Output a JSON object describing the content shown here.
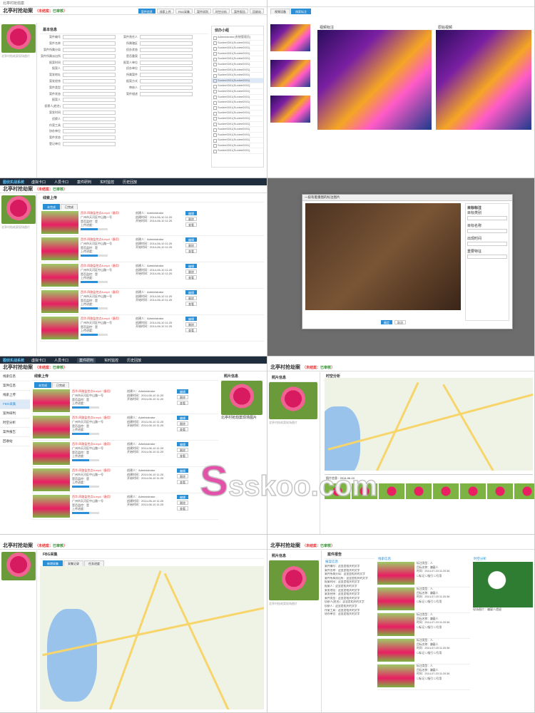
{
  "app": {
    "name": "图侦实战系统",
    "nav": [
      "虚拟卡口",
      "人员卡口",
      "案件研判",
      "实时监控",
      "历史回放"
    ]
  },
  "case": {
    "title": "北亭村抢劫案",
    "status_open": "未结案",
    "status_review": "已审核",
    "breadcrumb": "北亭村抢劫案"
  },
  "toolbar": [
    "案件信息",
    "线索上传",
    "FBG采集",
    "案件研判",
    "时空分析",
    "案件报告",
    "回收站"
  ],
  "panel1": {
    "side_caption": "北亭村抢劫案现场图片",
    "section_basic": "基本信息",
    "section_people": "侦办小组",
    "fields_left": [
      "案件编号",
      "案件名称",
      "案件所属分局",
      "案件所属派出所",
      "报案时间",
      "报案人",
      "案发地址",
      "案发经纬",
      "案件类型",
      "案件状态",
      "报案人",
      "侦察人(姓名)",
      "案发时间",
      "侦察人",
      "作案工具",
      "协办单位",
      "案件状态",
      "登记单位"
    ],
    "fields_right": [
      "案件责任人",
      "所属辖区",
      "侦办状态",
      "是否重案",
      "报案人单位",
      "侦办单位",
      "所属案件",
      "报案方式",
      "审核人",
      "案件描述"
    ],
    "people_header": "Administrator(系统管理员)",
    "people": [
      "Sunlee0001(Sunlee0001)",
      "Sunlee0001(Sunlee0001)",
      "Sunlee0001(Sunlee0001)",
      "Sunlee0001(Sunlee0001)",
      "Sunlee0001(Sunlee0001)",
      "Sunlee0001(Sunlee0001)",
      "Sunlee0001(Sunlee0001)",
      "Sunlee0001(Sunlee0001)",
      "Sunlee0001(Sunlee0001)",
      "Sunlee0001(Sunlee0001)",
      "Sunlee0001(Sunlee0001)",
      "Sunlee0001(Sunlee0001)",
      "Sunlee0001(Sunlee0001)",
      "Sunlee0001(Sunlee0001)",
      "Sunlee0001(Sunlee0001)",
      "Sunlee0001(Sunlee0001)",
      "Sunlee0001(Sunlee0001)",
      "Sunlee0001(Sunlee0001)",
      "Sunlee0001(Sunlee0001)",
      "Sunlee0001(Sunlee0001)",
      "Sunlee0001(Sunlee0001)"
    ]
  },
  "panel2": {
    "tabs": [
      "视频设备",
      "线索标注"
    ],
    "left_video": "视频标注",
    "right_video": "原始视频",
    "btn_label": "标注",
    "btn_delete": "删除"
  },
  "panel3": {
    "section": "线索上传",
    "tabs": [
      "未完成",
      "已完成"
    ],
    "upload_opts": [
      "翻拍",
      "上传视频",
      "上传图片",
      "上传文件"
    ],
    "title": "西华-四路监控点A.mp4（备用）",
    "addr": "广州市天河区中山路一号",
    "cam": "是否监控：是",
    "uploader": "创建人：Administrator",
    "time1": "创建时间：2014-06-10 11:20",
    "time2": "开始时间：2014-06-10 11:20",
    "pct_label": "上传进度：",
    "pct": 0.62,
    "actions": [
      "编辑",
      "删除",
      "查看"
    ]
  },
  "panel4": {
    "title": "一段有着重图的标注图片",
    "annot_title": "目标标注",
    "annot_fields": [
      "目标类别",
      "目标名称",
      "出现时间",
      "重要特征"
    ],
    "ok": "确定",
    "cancel": "取消",
    "color_label": "颜色选择"
  },
  "panel5": {
    "menu": [
      "线索信息",
      "案件信息",
      "线索上传",
      "FBG采集",
      "案件研判",
      "时空分析",
      "案件报告",
      "回收站"
    ],
    "side_title": "照片信息",
    "side_caption": "北亭村抢劫案现场图片"
  },
  "panel6": {
    "side_title": "照片信息",
    "section": "时空分析",
    "side_caption": "北亭村抢劫案现场图片",
    "timeline": "2014-06-10",
    "film_label": "照片信息",
    "play_label": "播放"
  },
  "panel7": {
    "section": "FBG采集",
    "tabs": [
      "新增采集",
      "采集记录",
      "任务进度"
    ],
    "right_link": "查看采集"
  },
  "panel8": {
    "side_title": "照片信息",
    "section": "案件报告",
    "sub1": "报案信息",
    "sub2": "线索信息",
    "sub3": "时空分析",
    "report_lines": [
      "案件编号：这里是相关的文字",
      "案件名称：这里是相关的文字",
      "案件所属分局：这里是相关的文字",
      "案件所属派出所：这里是相关的文字",
      "报案时间：这里是相关的文字",
      "报案人：这里是相关的文字",
      "案发地址：这里是相关的文字",
      "案发经纬：这里是相关的文字",
      "案件类型：这里是相关的文字",
      "侦察人(姓名)：这里是相关的文字",
      "侦察人：这里是相关的文字",
      "作案工具：这里是相关的文字",
      "协办单位：这里是相关的文字"
    ],
    "clue_lines": [
      "标注类型：人",
      "目标名称：嫌疑人",
      "时间：2014-07-03 11:20:36"
    ],
    "photo_caption": "现场图片：嫌疑人遗留",
    "checks": [
      "标记",
      "指引",
      "引用"
    ]
  },
  "watermark": "sskoo.com"
}
